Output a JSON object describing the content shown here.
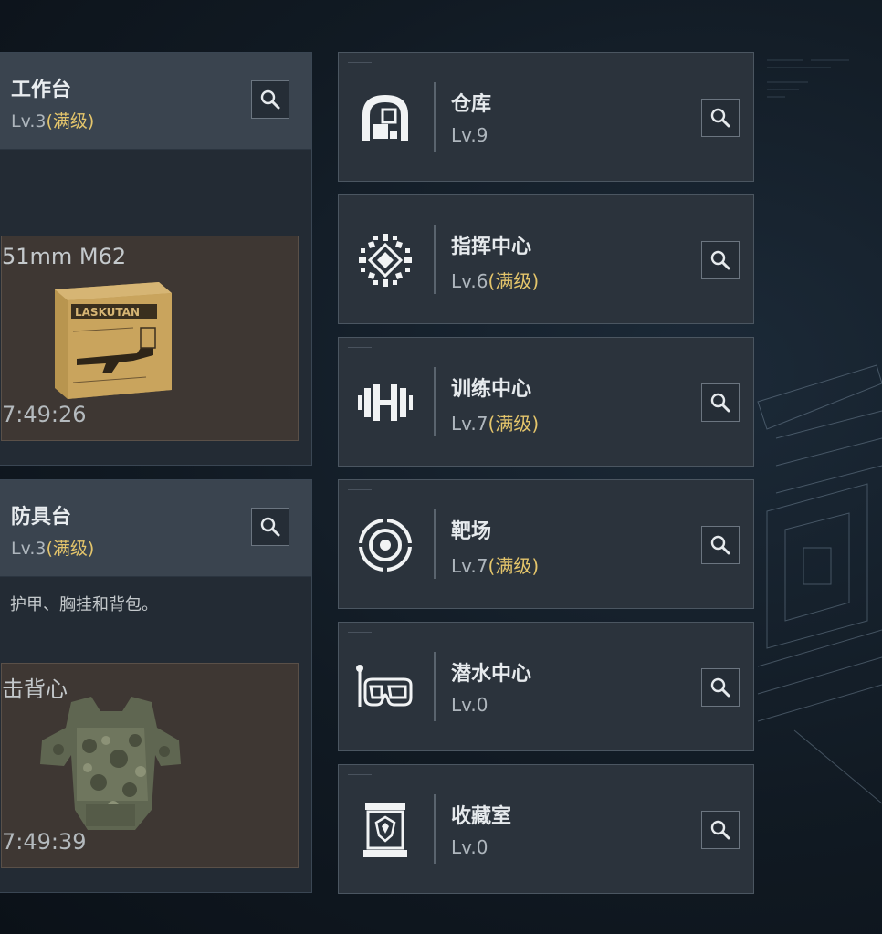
{
  "left_cards": [
    {
      "title": "工作台",
      "level": "Lv.3",
      "maxed_label": "(满级)",
      "item_name": "51mm M62",
      "timer": "7:49:26",
      "item_icon": "ammo-box-icon"
    },
    {
      "title": "防具台",
      "level": "Lv.3",
      "maxed_label": "(满级)",
      "description": "护甲、胸挂和背包。",
      "item_name": "击背心",
      "timer": "7:49:39",
      "item_icon": "body-armor-icon"
    }
  ],
  "facilities": [
    {
      "name": "仓库",
      "level": "Lv.9",
      "maxed_label": "",
      "icon": "warehouse-icon"
    },
    {
      "name": "指挥中心",
      "level": "Lv.6",
      "maxed_label": "(满级)",
      "icon": "command-chip-icon"
    },
    {
      "name": "训练中心",
      "level": "Lv.7",
      "maxed_label": "(满级)",
      "icon": "dumbbell-icon"
    },
    {
      "name": "靶场",
      "level": "Lv.7",
      "maxed_label": "(满级)",
      "icon": "target-icon"
    },
    {
      "name": "潜水中心",
      "level": "Lv.0",
      "maxed_label": "",
      "icon": "dive-mask-icon"
    },
    {
      "name": "收藏室",
      "level": "Lv.0",
      "maxed_label": "",
      "icon": "display-case-icon"
    }
  ],
  "colors": {
    "maxed": "#e4c56b",
    "card_bg": "#2b333c",
    "header_bg": "#3a444f",
    "panel_bg": "#3e3733"
  }
}
